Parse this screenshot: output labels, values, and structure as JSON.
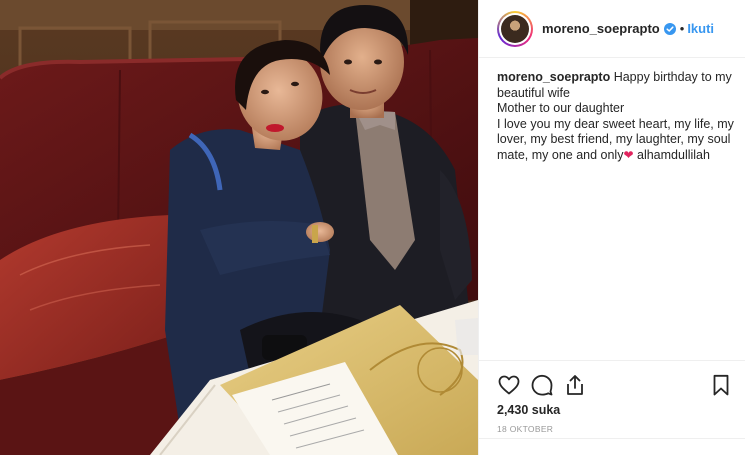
{
  "header": {
    "username": "moreno_soeprapto",
    "separator": "•",
    "follow_label": "Ikuti",
    "avatar_icon": "avatar-photo",
    "verified_icon": "verified-badge-icon"
  },
  "caption": {
    "username": "moreno_soeprapto",
    "line1": "Happy birthday to my beautiful wife",
    "line2": "Mother to our daughter",
    "line3": "I love you my dear sweet heart, my life, my lover, my best friend, my laughter, my soul mate, my one and only",
    "heart": "❤",
    "line3_end": " alhamdullilah"
  },
  "actions": {
    "like_icon": "heart-outline-icon",
    "comment_icon": "comment-icon",
    "share_icon": "share-icon",
    "save_icon": "bookmark-icon"
  },
  "stats": {
    "likes": "2,430 suka",
    "date": "18 OKTOBER"
  },
  "colors": {
    "link": "#3897f0",
    "verified": "#3897f0",
    "heart": "#e0245e",
    "text": "#262626",
    "muted": "#999999"
  }
}
